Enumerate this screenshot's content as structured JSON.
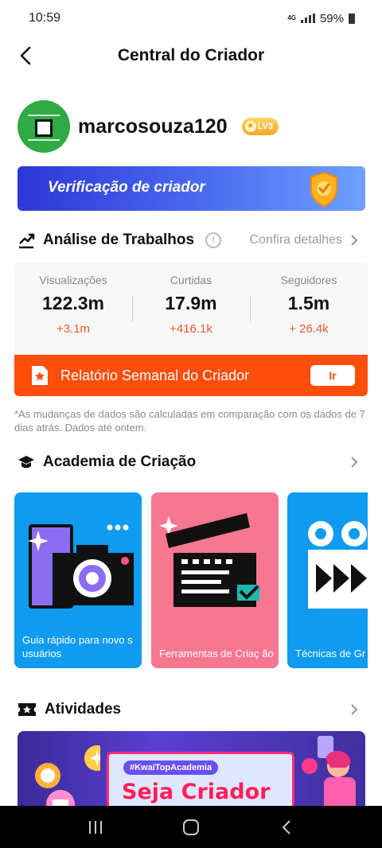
{
  "status_bar": {
    "time": "10:59",
    "network": "4G",
    "battery": "59%"
  },
  "header": {
    "title": "Central do Criador"
  },
  "profile": {
    "username": "marcosouza120",
    "level_badge": "LV3"
  },
  "verification_banner": {
    "label": "Verificação de criador"
  },
  "analysis": {
    "title": "Análise de Trabalhos",
    "details_link": "Confira detalhes",
    "stats": [
      {
        "label": "Visualizações",
        "value": "122.3m",
        "delta": "+3.1m"
      },
      {
        "label": "Curtidas",
        "value": "17.9m",
        "delta": "+416.1k"
      },
      {
        "label": "Seguidores",
        "value": "1.5m",
        "delta": "+ 26.4k"
      }
    ],
    "report": {
      "label": "Relatório Semanal do Criador",
      "button": "Ir"
    },
    "note": "*As mudanças de dados são calculadas em comparação com os dados de 7 dias atrás. Dados até ontem."
  },
  "academy": {
    "title": "Academia de Criação",
    "cards": [
      {
        "label": "Guia rápido para novo s usuários",
        "color": "#0f9bf0"
      },
      {
        "label": "Ferramentas de Criaç ão",
        "color": "#f77690"
      },
      {
        "label": "Técnicas de Gr",
        "color": "#0f9bf0"
      }
    ]
  },
  "activities": {
    "title": "Atividades",
    "banner_tag": "#KwaiTopAcademia",
    "banner_title": "Seja Criador"
  },
  "colors": {
    "accent": "#ff4d0a",
    "delta": "#f05a28",
    "verify_blue": "#3446e0"
  }
}
